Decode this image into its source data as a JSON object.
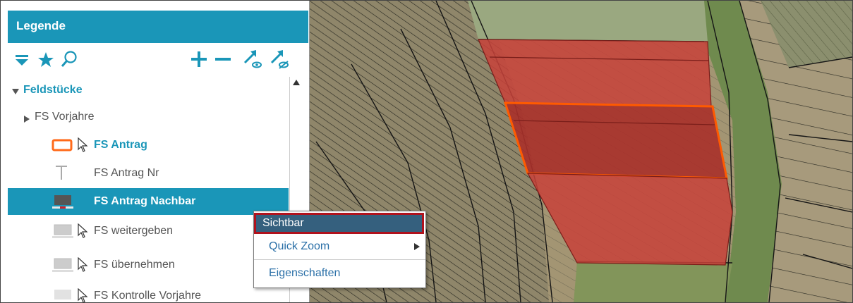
{
  "legend": {
    "title": "Legende",
    "toolbar": {
      "filter_icon": "filter-icon",
      "favorite_icon": "star-icon",
      "search_icon": "search-icon",
      "add_icon": "plus-icon",
      "remove_icon": "minus-icon",
      "show_icon": "visible-arrow-icon",
      "hide_icon": "hidden-arrow-icon"
    },
    "group": {
      "label": "Feldstücke",
      "expanded": true
    },
    "items": [
      {
        "label": "FS Vorjahre",
        "type": "collapsed-folder"
      },
      {
        "label": "FS Antrag",
        "type": "polygon-outline"
      },
      {
        "label": "FS Antrag Nr",
        "type": "text-layer"
      },
      {
        "label": "FS Antrag Nachbar",
        "type": "selected-layer"
      },
      {
        "label": "FS weitergeben",
        "type": "layer"
      },
      {
        "label": "FS übernehmen",
        "type": "layer"
      },
      {
        "label": "FS Kontrolle Vorjahre",
        "type": "layer"
      }
    ],
    "selected_item": "FS Antrag Nachbar"
  },
  "context_menu": {
    "items": [
      {
        "label": "Sichtbar",
        "highlighted": true
      },
      {
        "label": "Quick Zoom",
        "has_submenu": true
      },
      {
        "label": "Eigenschaften"
      }
    ]
  },
  "colors": {
    "accent": "#1a96b8",
    "menu_highlight": "#35607e",
    "highlight_border": "#b0121d",
    "parcel_fill": "#c8423a",
    "parcel_outline": "#ff5a00"
  }
}
